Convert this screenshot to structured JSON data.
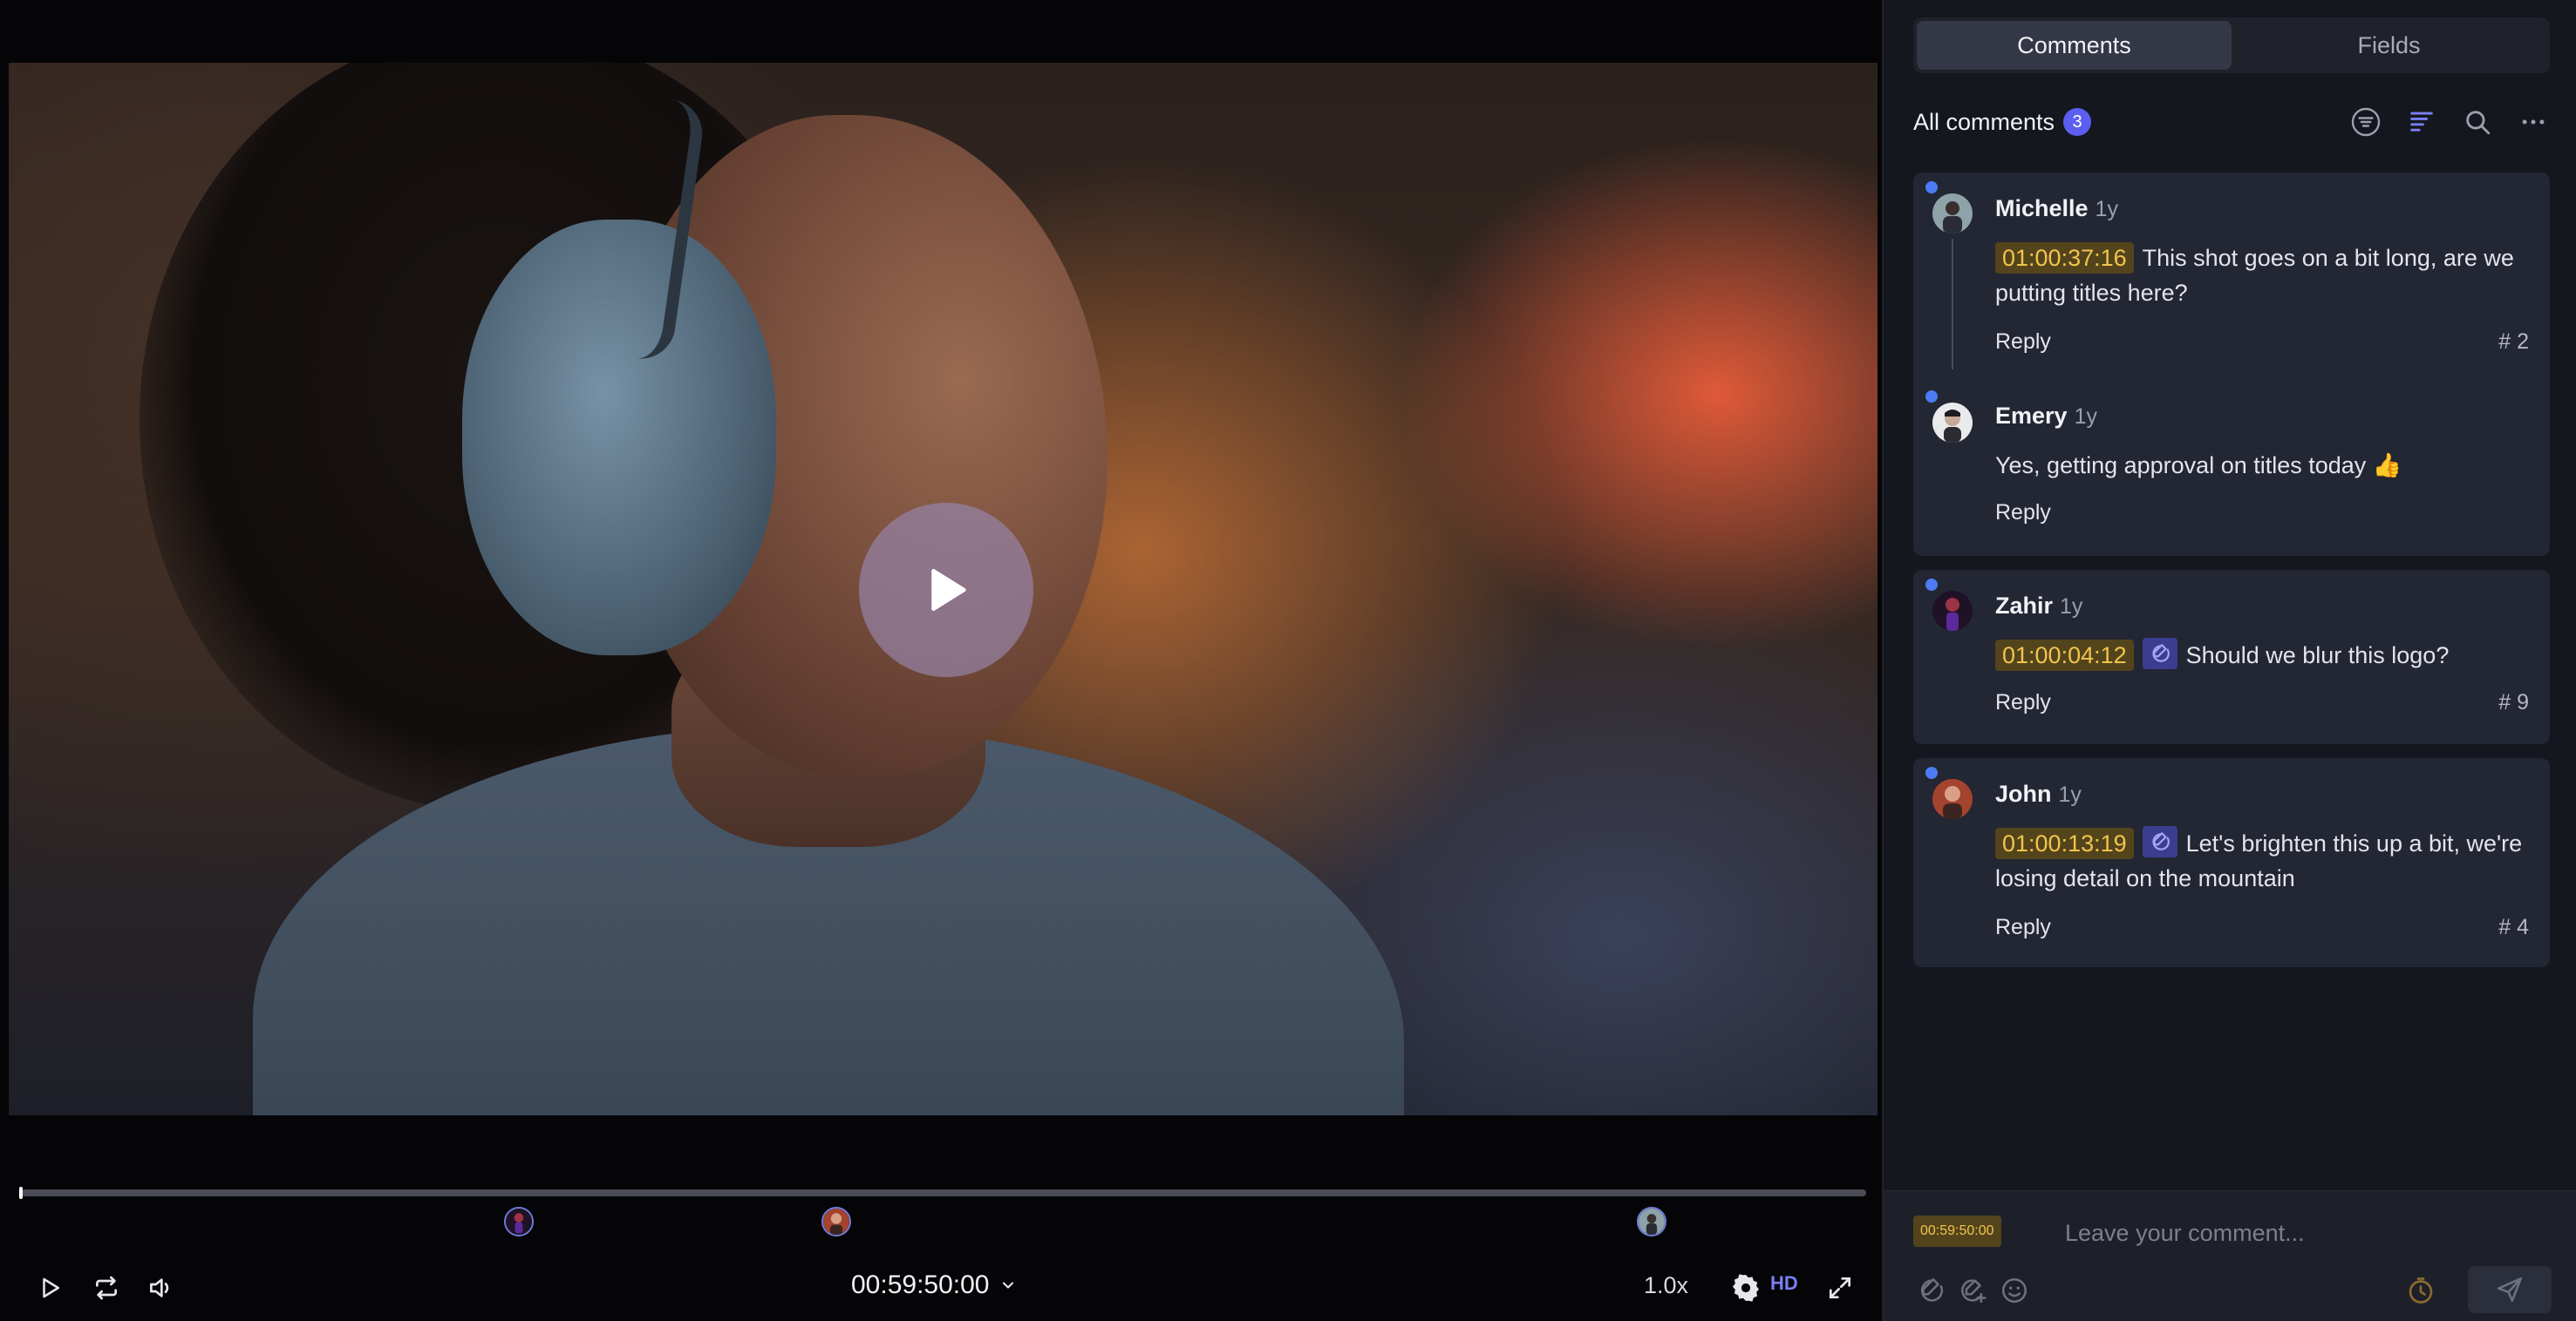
{
  "player": {
    "timecode": "00:59:50:00",
    "speed": "1.0x",
    "quality": "HD",
    "progress_fraction": 0.0,
    "controls": [
      "play-icon",
      "loop-icon",
      "volume-icon",
      "chevron-down-icon",
      "gear-icon",
      "fullscreen-icon"
    ],
    "timeline_markers": [
      {
        "avatar": "zahir",
        "color": "#6f7bd9"
      },
      {
        "avatar": "john",
        "color": "#6f7bd9"
      },
      {
        "avatar": "michelle",
        "color": "#6f7bd9"
      }
    ]
  },
  "sidebar": {
    "tabs": [
      {
        "label": "Comments",
        "active": true
      },
      {
        "label": "Fields",
        "active": false
      }
    ],
    "header": {
      "title": "All comments",
      "count": "3",
      "icons": [
        "filter-icon",
        "sort-icon",
        "search-icon",
        "more-icon"
      ]
    },
    "threads": [
      {
        "comments": [
          {
            "author": "Michelle",
            "age": "1y",
            "timecode": "01:00:37:16",
            "has_drawing": false,
            "text": "This shot goes on a bit long, are we putting titles here?",
            "reply_label": "Reply",
            "number": "# 2",
            "unread": true
          },
          {
            "author": "Emery",
            "age": "1y",
            "timecode": "",
            "has_drawing": false,
            "text": "Yes, getting approval on titles today 👍",
            "reply_label": "Reply",
            "number": "",
            "unread": true
          }
        ]
      },
      {
        "comments": [
          {
            "author": "Zahir",
            "age": "1y",
            "timecode": "01:00:04:12",
            "has_drawing": true,
            "text": "Should we blur this logo?",
            "reply_label": "Reply",
            "number": "# 9",
            "unread": true
          }
        ]
      },
      {
        "comments": [
          {
            "author": "John",
            "age": "1y",
            "timecode": "01:00:13:19",
            "has_drawing": true,
            "text": "Let's brighten this up a bit, we're losing detail on the mountain",
            "reply_label": "Reply",
            "number": "# 4",
            "unread": true
          }
        ]
      }
    ],
    "composer": {
      "timecode": "00:59:50:00",
      "placeholder": "Leave your comment...",
      "icons": [
        "attach-icon",
        "annotate-icon",
        "emoji-icon",
        "timestamp-icon",
        "send-icon"
      ]
    }
  },
  "colors": {
    "accent": "#5b5ef0",
    "timecode_bg": "#54441c",
    "timecode_text": "#f0c54c",
    "unread_dot": "#4c7bf4"
  }
}
